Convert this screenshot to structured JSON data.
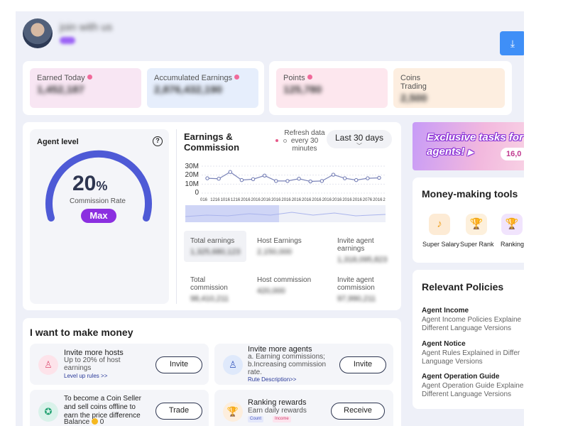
{
  "header": {
    "user_name": "join with us",
    "download_icon": "download-icon"
  },
  "stats_left": [
    {
      "label": "Earned Today",
      "value": "1,452,187",
      "bg": "#f8e6f3"
    },
    {
      "label": "Accumulated Earnings",
      "value": "2,876,432,190",
      "bg": "#e6eefc"
    }
  ],
  "stats_right": [
    {
      "label": "Points",
      "value": "125,780",
      "bg": "#fde7ee"
    },
    {
      "label": "Coins Trading",
      "value": "2,500",
      "bg": "#fdeee0"
    }
  ],
  "agent": {
    "title": "Agent level",
    "help": "?",
    "percent": "20",
    "percent_sign": "%",
    "rate_label": "Commission Rate",
    "level_badge": "Max",
    "gauge_fill": 1.0
  },
  "earnings": {
    "title": "Earnings & Commission",
    "refresh": "Refresh data every 30 minutes",
    "period": "Last 30 days",
    "stats": [
      {
        "label": "Total earnings",
        "value": "1,325,680,123"
      },
      {
        "label": "Host Earnings",
        "value": "2,150,000"
      },
      {
        "label": "Invite agent earnings",
        "value": "1,318,095,823"
      },
      {
        "label": "Total commission",
        "value": "98,410,211"
      },
      {
        "label": "Host commission",
        "value": "420,000"
      },
      {
        "label": "Invite agent commission",
        "value": "97,990,211"
      }
    ]
  },
  "chart_data": {
    "type": "line",
    "y_tick_labels": [
      "30M",
      "20M",
      "10M",
      "0"
    ],
    "ylim": [
      0,
      30
    ],
    "x_tick_labels": [
      "016",
      "1216",
      "1016",
      "1216",
      "2016",
      "2016",
      "2016",
      "2016",
      "2016",
      "2016",
      "2016",
      "2016",
      "2016",
      "2016",
      "2016",
      "2016",
      "2076",
      "2016",
      "2"
    ],
    "values": [
      16.5,
      16,
      23.5,
      14.5,
      15.5,
      19.5,
      13.5,
      13.5,
      16,
      13,
      13.5,
      20.5,
      16.5,
      14.5,
      16.5,
      17
    ],
    "grid": true
  },
  "banner": {
    "line1": "Exclusive tasks for",
    "line2": "agents!",
    "num": "16,0"
  },
  "tools": {
    "title": "Money-making tools",
    "items": [
      {
        "label": "Super Salary",
        "icon": "coin-icon",
        "glyph": "♪",
        "bg": "#fdebd5",
        "fg": "#f0a020"
      },
      {
        "label": "Super Rank",
        "icon": "trophy-icon",
        "glyph": "🏆",
        "bg": "#fdf0dc",
        "fg": "#e8a028"
      },
      {
        "label": "Ranking",
        "icon": "ranking-trophy-icon",
        "glyph": "🏆",
        "bg": "#f1e4fd",
        "fg": "#a050e0"
      }
    ]
  },
  "policies": {
    "title": "Relevant Policies",
    "items": [
      {
        "heading": "Agent Income",
        "line1": "Agent Income Policies Explaine",
        "line2": "Different Language Versions"
      },
      {
        "heading": "Agent Notice",
        "line1": "Agent Rules Explained in Differ",
        "line2": "Language Versions"
      },
      {
        "heading": "Agent Operation Guide",
        "line1": "Agent Operation Guide Explaine",
        "line2": "Different Language Versions"
      }
    ]
  },
  "make_money": {
    "title": "I want to make money",
    "invite_hosts": {
      "title": "Invite more hosts",
      "desc": "Up to 20% of host earnings",
      "link": "Level up rules >>",
      "button": "Invite"
    },
    "invite_agents": {
      "title": "Invite more agents",
      "desc": "a. Earning commissions; b.Increasing commission rate.",
      "link": "Rute Description>>",
      "button": "Invite"
    },
    "coin_seller": {
      "title": "To become a Coin Seller and sell coins offline to earn the price difference",
      "balance_label": "Balance",
      "balance_value": "0",
      "button": "Trade"
    },
    "ranking": {
      "title": "Ranking rewards",
      "desc": "Earn daily rewards",
      "tag1": "Count",
      "tag2": "Income",
      "button": "Receive"
    }
  }
}
